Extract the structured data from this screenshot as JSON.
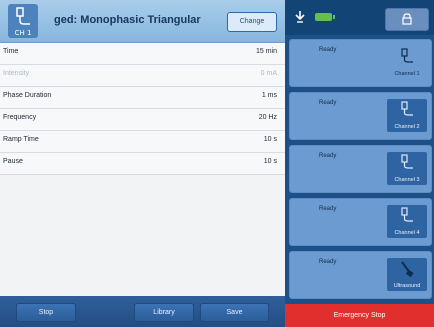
{
  "header": {
    "icon": "channel-probe-icon",
    "channel_number": "CH 1",
    "title": "ged: Monophasic Triangular",
    "change_label": "Change"
  },
  "params": [
    {
      "label": "Time",
      "value": "15 min",
      "disabled": false
    },
    {
      "label": "Intensity",
      "value": "0 mA",
      "disabled": true
    },
    {
      "label": "Phase Duration",
      "value": "1 ms",
      "disabled": false
    },
    {
      "label": "Frequency",
      "value": "20 Hz",
      "disabled": false
    },
    {
      "label": "Ramp Time",
      "value": "10 s",
      "disabled": false
    },
    {
      "label": "Pause",
      "value": "10 s",
      "disabled": false
    }
  ],
  "bottom": {
    "stop_label": "Stop",
    "library_label": "Library",
    "save_label": "Save"
  },
  "status_bar": {
    "pulse_icon": "pulse-icon",
    "battery_icon": "battery-icon",
    "lock_icon": "lock-icon"
  },
  "channels": [
    {
      "status": "Ready",
      "label": "Channel 1",
      "active": false
    },
    {
      "status": "Ready",
      "label": "Channel 2",
      "active": true
    },
    {
      "status": "Ready",
      "label": "Channel 3",
      "active": true
    },
    {
      "status": "Ready",
      "label": "Channel 4",
      "active": true
    },
    {
      "status": "Ready",
      "label": "Ultrasound",
      "active": true
    }
  ],
  "emergency_stop_label": "Emergency Stop",
  "colors": {
    "background": "#1d4f88",
    "panel": "#f1f3f5",
    "channel_tile": "#6b9bd0",
    "channel_active": "#2f64a3",
    "emergency": "#e02f2c",
    "battery": "#62c14b"
  }
}
